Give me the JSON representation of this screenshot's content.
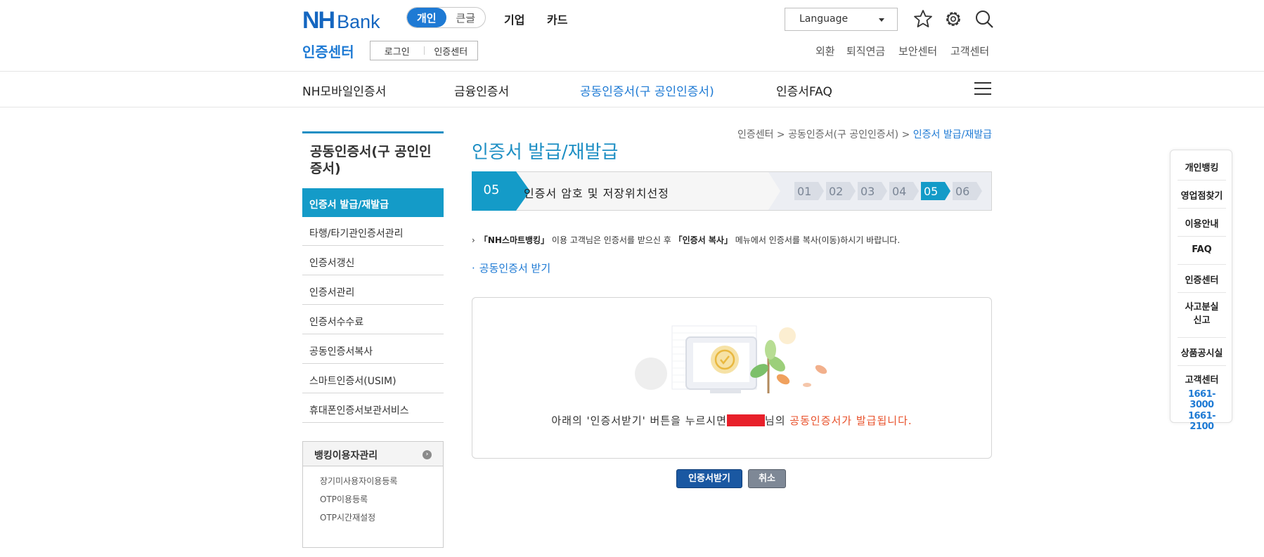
{
  "header": {
    "logo_nh": "NH",
    "logo_bank": "Bank",
    "mode_personal": "개인",
    "mode_large": "큰글",
    "nav_corp": "기업",
    "nav_card": "카드",
    "language": "Language",
    "cert_center": "인증센터",
    "login": "로그인",
    "cert_center_btn": "인증센터",
    "links": [
      "외환",
      "퇴직연금",
      "보안센터",
      "고객센터"
    ]
  },
  "mainnav": [
    "NH모바일인증서",
    "금융인증서",
    "공동인증서(구 공인인증서)",
    "인증서FAQ"
  ],
  "leftmenu": {
    "title": "공동인증서(구 공인인증서)",
    "items": [
      "인증서 발급/재발급",
      "타행/타기관인증서관리",
      "인증서갱신",
      "인증서관리",
      "인증서수수료",
      "공동인증서복사",
      "스마트인증서(USIM)",
      "휴대폰인증서보관서비스"
    ],
    "box_title": "뱅킹이용자관리",
    "box_items": [
      "장기미사용자이용등록",
      "OTP이용등록",
      "OTP시간재설정"
    ]
  },
  "breadcrumb": {
    "root": "인증센터 > 공동인증서(구 공인인증서) > ",
    "current": "인증서 발급/재발급"
  },
  "page_title": "인증서 발급/재발급",
  "step": {
    "current_num": "05",
    "current_label": "인증서 암호 및 저장위치선정",
    "chips": [
      "01",
      "02",
      "03",
      "04",
      "05",
      "06"
    ]
  },
  "notes": {
    "n1_pre": "「NH스마트뱅킹」",
    "n1_mid": " 이용 고객님은 인증서를 받으신 후 ",
    "n1_bold": "「인증서 복사」",
    "n1_post": " 메뉴에서 인증서를 복사(이동)하시기 바랍니다.",
    "n2": "공동인증서 받기"
  },
  "message": {
    "pre": "아래의 '인증서받기' 버튼을 누르시면",
    "mid": "님의 ",
    "highlight": "공동인증서가 발급됩니다."
  },
  "buttons": {
    "ok": "인증서받기",
    "cancel": "취소"
  },
  "quick": {
    "items": [
      "개인뱅킹",
      "영업점찾기",
      "이용안내",
      "FAQ",
      "인증센터",
      "사고분실\n신고",
      "상품공시실",
      "고객센터"
    ],
    "phone1": "1661-3000",
    "phone2": "1661-2100"
  },
  "colors": {
    "brand": "#1466c0",
    "accent": "#149bc8",
    "highlight": "#e8502a"
  }
}
